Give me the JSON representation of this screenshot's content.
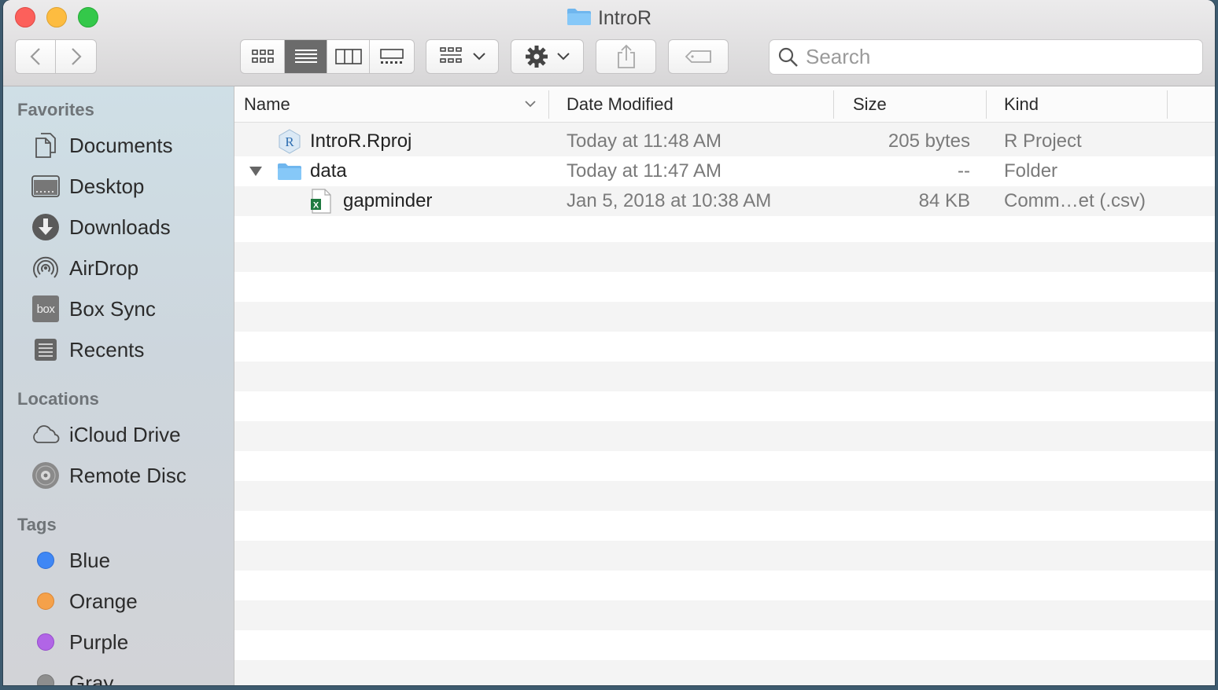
{
  "window": {
    "title": "IntroR"
  },
  "toolbar": {
    "search_placeholder": "Search"
  },
  "sidebar": {
    "favorites_heading": "Favorites",
    "favorites": [
      {
        "label": "Documents",
        "icon": "documents-icon"
      },
      {
        "label": "Desktop",
        "icon": "desktop-icon"
      },
      {
        "label": "Downloads",
        "icon": "downloads-icon"
      },
      {
        "label": "AirDrop",
        "icon": "airdrop-icon"
      },
      {
        "label": "Box Sync",
        "icon": "box-sync-icon",
        "icon_text": "box"
      },
      {
        "label": "Recents",
        "icon": "recents-icon"
      }
    ],
    "locations_heading": "Locations",
    "locations": [
      {
        "label": "iCloud Drive",
        "icon": "icloud-icon"
      },
      {
        "label": "Remote Disc",
        "icon": "remote-disc-icon"
      }
    ],
    "tags_heading": "Tags",
    "tags": [
      {
        "label": "Blue",
        "color": "#3f87f5"
      },
      {
        "label": "Orange",
        "color": "#f5a14a"
      },
      {
        "label": "Purple",
        "color": "#b165e6"
      },
      {
        "label": "Gray",
        "color": "#8e8e8e"
      }
    ]
  },
  "list": {
    "columns": {
      "name": "Name",
      "date": "Date Modified",
      "size": "Size",
      "kind": "Kind"
    },
    "rows": [
      {
        "name": "IntroR.Rproj",
        "date": "Today at 11:48 AM",
        "size": "205 bytes",
        "kind": "R Project",
        "icon": "r-project-file-icon",
        "icon_text": "R"
      },
      {
        "name": "data",
        "date": "Today at 11:47 AM",
        "size": "--",
        "kind": "Folder",
        "icon": "folder-icon",
        "expanded": true
      },
      {
        "name": "gapminder",
        "date": "Jan 5, 2018 at 10:38 AM",
        "size": "84 KB",
        "kind": "Comm…et (.csv)",
        "icon": "csv-file-icon",
        "icon_text": "X"
      }
    ]
  }
}
